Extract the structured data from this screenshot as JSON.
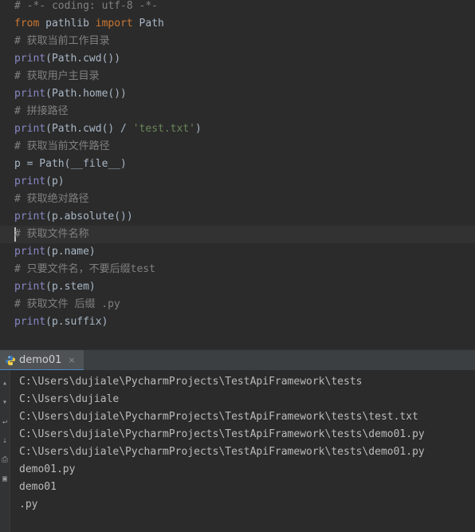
{
  "editor": {
    "lines": [
      {
        "parts": [
          {
            "t": "# -*- coding: utf-8 -*-",
            "c": "cm"
          }
        ]
      },
      {
        "parts": [
          {
            "t": "from",
            "c": "kw"
          },
          {
            "t": " pathlib ",
            "c": "pl"
          },
          {
            "t": "import",
            "c": "kw"
          },
          {
            "t": " Path",
            "c": "pl"
          }
        ]
      },
      {
        "parts": [
          {
            "t": "# 获取当前工作目录",
            "c": "cm"
          }
        ]
      },
      {
        "parts": [
          {
            "t": "print",
            "c": "fn"
          },
          {
            "t": "(Path.cwd())",
            "c": "pl"
          }
        ]
      },
      {
        "parts": [
          {
            "t": "# 获取用户主目录",
            "c": "cm"
          }
        ]
      },
      {
        "parts": [
          {
            "t": "print",
            "c": "fn"
          },
          {
            "t": "(Path.home())",
            "c": "pl"
          }
        ]
      },
      {
        "parts": [
          {
            "t": "# 拼接路径",
            "c": "cm"
          }
        ]
      },
      {
        "parts": [
          {
            "t": "print",
            "c": "fn"
          },
          {
            "t": "(Path.cwd() / ",
            "c": "pl"
          },
          {
            "t": "'test.txt'",
            "c": "str"
          },
          {
            "t": ")",
            "c": "pl"
          }
        ]
      },
      {
        "parts": [
          {
            "t": "# 获取当前文件路径",
            "c": "cm"
          }
        ]
      },
      {
        "parts": [
          {
            "t": "p = Path(__file__)",
            "c": "pl"
          }
        ]
      },
      {
        "parts": [
          {
            "t": "print",
            "c": "fn"
          },
          {
            "t": "(p)",
            "c": "pl"
          }
        ]
      },
      {
        "parts": [
          {
            "t": "# 获取绝对路径",
            "c": "cm"
          }
        ]
      },
      {
        "parts": [
          {
            "t": "print",
            "c": "fn"
          },
          {
            "t": "(p.absolute())",
            "c": "pl"
          }
        ]
      },
      {
        "parts": [
          {
            "t": "# 获取文件名称",
            "c": "cm"
          }
        ]
      },
      {
        "parts": [
          {
            "t": "print",
            "c": "fn"
          },
          {
            "t": "(p.name)",
            "c": "pl"
          }
        ]
      },
      {
        "parts": [
          {
            "t": "# 只要文件名，不要后缀test",
            "c": "cm"
          }
        ]
      },
      {
        "parts": [
          {
            "t": "print",
            "c": "fn"
          },
          {
            "t": "(p.stem)",
            "c": "pl"
          }
        ]
      },
      {
        "parts": [
          {
            "t": "# 获取文件 后缀 .py",
            "c": "cm"
          }
        ]
      },
      {
        "parts": [
          {
            "t": "print",
            "c": "fn"
          },
          {
            "t": "(p.suffix)",
            "c": "pl"
          }
        ]
      }
    ],
    "current_line": 13
  },
  "run_panel": {
    "tab_label": "demo01",
    "close_glyph": "×"
  },
  "console": {
    "lines": [
      "C:\\Users\\dujiale\\PycharmProjects\\TestApiFramework\\tests",
      "C:\\Users\\dujiale",
      "C:\\Users\\dujiale\\PycharmProjects\\TestApiFramework\\tests\\test.txt",
      "C:\\Users\\dujiale\\PycharmProjects\\TestApiFramework\\tests\\demo01.py",
      "C:\\Users\\dujiale\\PycharmProjects\\TestApiFramework\\tests\\demo01.py",
      "demo01.py",
      "demo01",
      ".py"
    ]
  },
  "icons": {
    "python": "python-icon",
    "gutter": [
      "scroll-up-icon",
      "scroll-down-icon",
      "soft-wrap-icon",
      "scroll-to-end-icon",
      "print-icon",
      "trash-icon"
    ]
  },
  "colors": {
    "background": "#2b2b2b",
    "keyword": "#cc7832",
    "comment": "#808080",
    "string": "#6a8759",
    "builtin": "#8888c6",
    "text": "#a9b7c6"
  }
}
